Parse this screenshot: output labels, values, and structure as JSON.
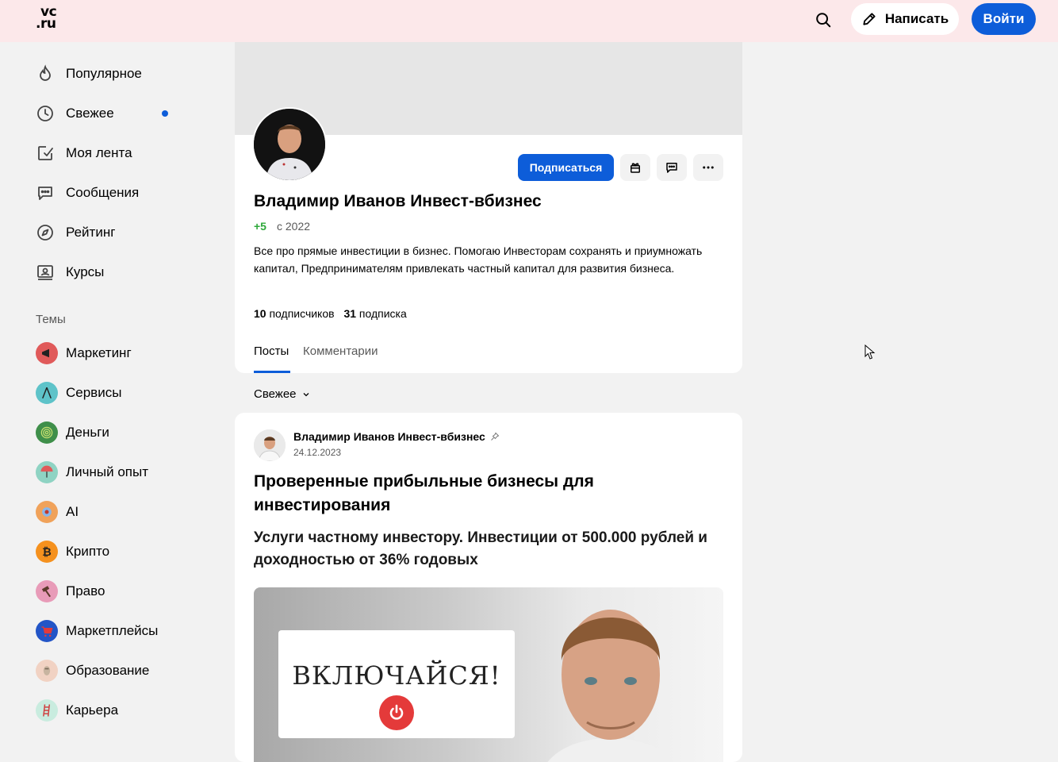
{
  "header": {
    "logo_line1": "vc",
    "logo_line2": ".ru",
    "write_label": "Написать",
    "login_label": "Войти"
  },
  "sidebar": {
    "nav": [
      {
        "label": "Популярное",
        "icon": "flame-icon"
      },
      {
        "label": "Свежее",
        "icon": "clock-icon",
        "has_new_dot": true
      },
      {
        "label": "Моя лента",
        "icon": "feed-check-icon"
      },
      {
        "label": "Сообщения",
        "icon": "chat-icon"
      },
      {
        "label": "Рейтинг",
        "icon": "compass-icon"
      },
      {
        "label": "Курсы",
        "icon": "courses-icon"
      }
    ],
    "themes_title": "Темы",
    "topics": [
      {
        "label": "Маркетинг",
        "color": "#e05a5a"
      },
      {
        "label": "Сервисы",
        "color": "#5ec3c9"
      },
      {
        "label": "Деньги",
        "color": "#3f8f4a"
      },
      {
        "label": "Личный опыт",
        "color": "#8fd3c3"
      },
      {
        "label": "AI",
        "color": "#f0a25a"
      },
      {
        "label": "Крипто",
        "color": "#f5911e"
      },
      {
        "label": "Право",
        "color": "#e89bb8"
      },
      {
        "label": "Маркетплейсы",
        "color": "#2355c7"
      },
      {
        "label": "Образование",
        "color": "#f1d2c3"
      },
      {
        "label": "Карьера",
        "color": "#c9ecdf"
      }
    ]
  },
  "profile": {
    "subscribe_label": "Подписаться",
    "name": "Владимир Иванов Инвест-вбизнес",
    "rating": "+5",
    "since": "с 2022",
    "bio": "Все про прямые инвестиции в бизнес. Помогаю Инвесторам сохранять и приумножать капитал, Предпринимателям привлекать частный капитал для развития бизнеса.",
    "followers_count": "10",
    "followers_label": "подписчиков",
    "following_count": "31",
    "following_label": "подписка",
    "tabs": [
      "Посты",
      "Комментарии"
    ]
  },
  "feed": {
    "sort_label": "Свежее"
  },
  "post": {
    "author": "Владимир Иванов Инвест-вбизнес",
    "date": "24.12.2023",
    "title": "Проверенные прибыльные бизнесы для инвестирования",
    "subtitle": "Услуги частному инвестору. Инвестиции от 500.000 рублей и доходностью от 36% годовых",
    "image_text": "ВКЛЮЧАЙСЯ!"
  },
  "colors": {
    "accent": "#0d5dd9",
    "header_bg": "#fce8ea",
    "rating_green": "#2ea83a"
  }
}
